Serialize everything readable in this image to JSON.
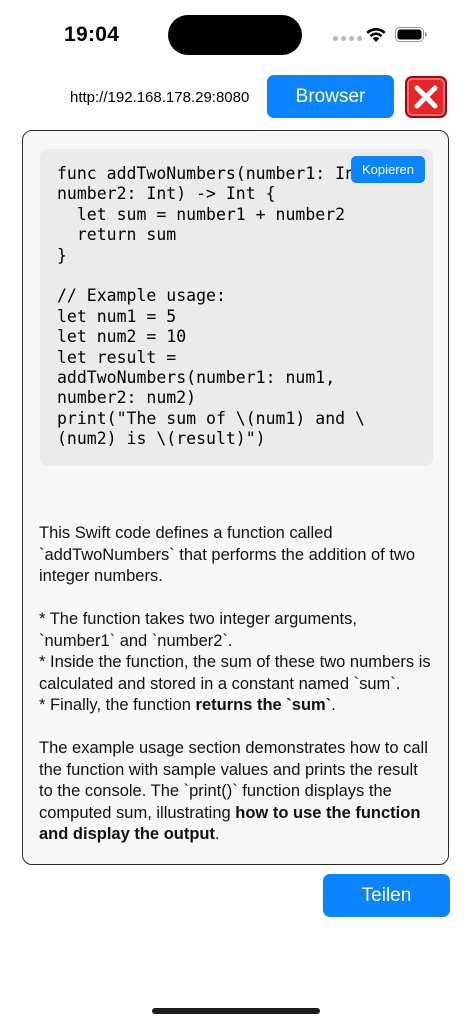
{
  "status_bar": {
    "time": "19:04"
  },
  "toolbar": {
    "url": "http://192.168.178.29:8080",
    "browser_label": "Browser",
    "close_icon": "red-x-close-icon"
  },
  "code_block": {
    "copy_label": "Kopieren",
    "code": "func addTwoNumbers(number1: Int,\nnumber2: Int) -> Int {\n  let sum = number1 + number2\n  return sum\n}\n\n// Example usage:\nlet num1 = 5\nlet num2 = 10\nlet result =\naddTwoNumbers(number1: num1,\nnumber2: num2)\nprint(\"The sum of \\(num1) and \\\n(num2) is \\(result)\")"
  },
  "description": {
    "p1": "This Swift code defines a function called `addTwoNumbers` that performs the addition of two integer numbers.",
    "bullet1": "* The function takes two integer arguments, `number1` and `number2`.",
    "bullet2": "* Inside the function, the sum of these two numbers is calculated and stored in a constant named `sum`.",
    "bullet3_pre": "* Finally, the function ",
    "bullet3_bold": "returns the `sum`",
    "bullet3_post": ".",
    "p3_pre": "The example usage section demonstrates how to call the function with sample values and prints the result to the console. The `print()` function displays the computed sum, illustrating ",
    "p3_bold": "how to use the function and display the output",
    "p3_post": "."
  },
  "footer": {
    "share_label": "Teilen"
  },
  "colors": {
    "accent": "#0a84ff",
    "close_red": "#e5252a",
    "code_background": "#ebebeb"
  }
}
